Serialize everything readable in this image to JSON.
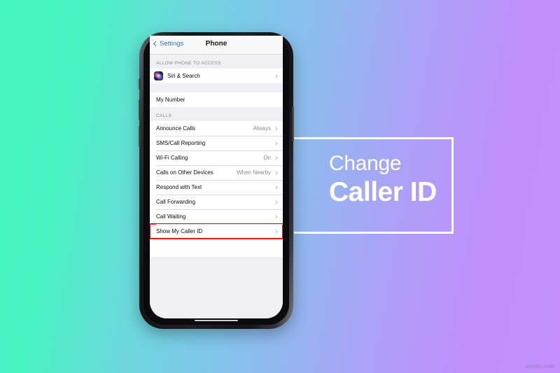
{
  "background": {
    "gradient_from": "#45f5c0",
    "gradient_mid": "#7ec8ea",
    "gradient_to": "#c48ffb"
  },
  "caption": {
    "line1": "Change",
    "line2": "Caller ID",
    "frame_color": "#ffffff"
  },
  "phone": {
    "nav": {
      "back_label": "Settings",
      "title": "Phone"
    },
    "sections": [
      {
        "header": "ALLOW PHONE TO ACCESS",
        "rows": [
          {
            "label": "Siri & Search",
            "value": "",
            "icon": "siri-icon",
            "chevron": true,
            "highlight": false
          }
        ]
      },
      {
        "header": "",
        "rows": [
          {
            "label": "My Number",
            "value": "",
            "icon": "",
            "chevron": false,
            "highlight": false
          }
        ]
      },
      {
        "header": "CALLS",
        "rows": [
          {
            "label": "Announce Calls",
            "value": "Always",
            "icon": "",
            "chevron": true,
            "highlight": false
          },
          {
            "label": "SMS/Call Reporting",
            "value": "",
            "icon": "",
            "chevron": true,
            "highlight": false
          },
          {
            "label": "Wi-Fi Calling",
            "value": "On",
            "icon": "",
            "chevron": true,
            "highlight": false
          },
          {
            "label": "Calls on Other Devices",
            "value": "When Nearby",
            "icon": "",
            "chevron": true,
            "highlight": false
          },
          {
            "label": "Respond with Text",
            "value": "",
            "icon": "",
            "chevron": true,
            "highlight": false
          },
          {
            "label": "Call Forwarding",
            "value": "",
            "icon": "",
            "chevron": true,
            "highlight": false
          },
          {
            "label": "Call Waiting",
            "value": "",
            "icon": "",
            "chevron": true,
            "highlight": false
          },
          {
            "label": "Show My Caller ID",
            "value": "",
            "icon": "",
            "chevron": true,
            "highlight": true
          }
        ]
      }
    ],
    "highlight_color": "#ee1b10"
  },
  "watermark": "wsxdn.com"
}
